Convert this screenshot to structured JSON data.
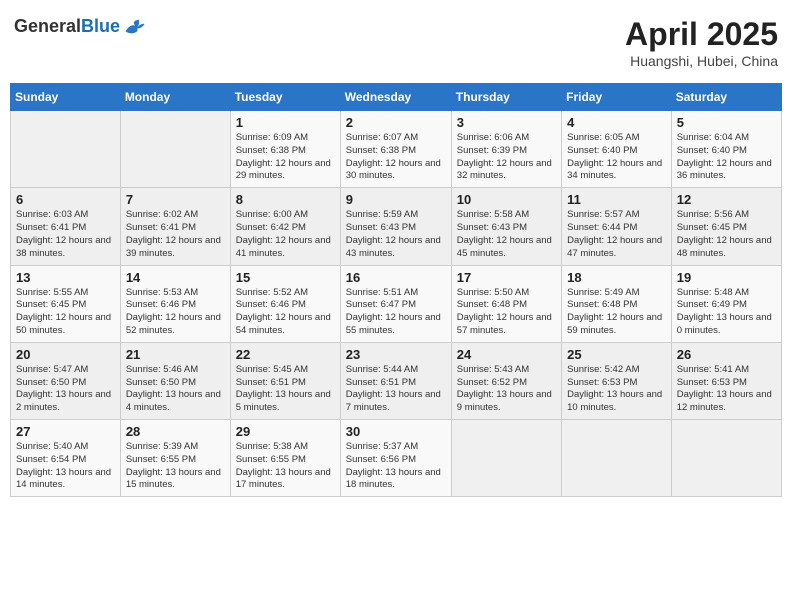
{
  "header": {
    "logo_general": "General",
    "logo_blue": "Blue",
    "month_title": "April 2025",
    "subtitle": "Huangshi, Hubei, China"
  },
  "days_of_week": [
    "Sunday",
    "Monday",
    "Tuesday",
    "Wednesday",
    "Thursday",
    "Friday",
    "Saturday"
  ],
  "weeks": [
    [
      {
        "day": "",
        "info": ""
      },
      {
        "day": "",
        "info": ""
      },
      {
        "day": "1",
        "info": "Sunrise: 6:09 AM\nSunset: 6:38 PM\nDaylight: 12 hours\nand 29 minutes."
      },
      {
        "day": "2",
        "info": "Sunrise: 6:07 AM\nSunset: 6:38 PM\nDaylight: 12 hours\nand 30 minutes."
      },
      {
        "day": "3",
        "info": "Sunrise: 6:06 AM\nSunset: 6:39 PM\nDaylight: 12 hours\nand 32 minutes."
      },
      {
        "day": "4",
        "info": "Sunrise: 6:05 AM\nSunset: 6:40 PM\nDaylight: 12 hours\nand 34 minutes."
      },
      {
        "day": "5",
        "info": "Sunrise: 6:04 AM\nSunset: 6:40 PM\nDaylight: 12 hours\nand 36 minutes."
      }
    ],
    [
      {
        "day": "6",
        "info": "Sunrise: 6:03 AM\nSunset: 6:41 PM\nDaylight: 12 hours\nand 38 minutes."
      },
      {
        "day": "7",
        "info": "Sunrise: 6:02 AM\nSunset: 6:41 PM\nDaylight: 12 hours\nand 39 minutes."
      },
      {
        "day": "8",
        "info": "Sunrise: 6:00 AM\nSunset: 6:42 PM\nDaylight: 12 hours\nand 41 minutes."
      },
      {
        "day": "9",
        "info": "Sunrise: 5:59 AM\nSunset: 6:43 PM\nDaylight: 12 hours\nand 43 minutes."
      },
      {
        "day": "10",
        "info": "Sunrise: 5:58 AM\nSunset: 6:43 PM\nDaylight: 12 hours\nand 45 minutes."
      },
      {
        "day": "11",
        "info": "Sunrise: 5:57 AM\nSunset: 6:44 PM\nDaylight: 12 hours\nand 47 minutes."
      },
      {
        "day": "12",
        "info": "Sunrise: 5:56 AM\nSunset: 6:45 PM\nDaylight: 12 hours\nand 48 minutes."
      }
    ],
    [
      {
        "day": "13",
        "info": "Sunrise: 5:55 AM\nSunset: 6:45 PM\nDaylight: 12 hours\nand 50 minutes."
      },
      {
        "day": "14",
        "info": "Sunrise: 5:53 AM\nSunset: 6:46 PM\nDaylight: 12 hours\nand 52 minutes."
      },
      {
        "day": "15",
        "info": "Sunrise: 5:52 AM\nSunset: 6:46 PM\nDaylight: 12 hours\nand 54 minutes."
      },
      {
        "day": "16",
        "info": "Sunrise: 5:51 AM\nSunset: 6:47 PM\nDaylight: 12 hours\nand 55 minutes."
      },
      {
        "day": "17",
        "info": "Sunrise: 5:50 AM\nSunset: 6:48 PM\nDaylight: 12 hours\nand 57 minutes."
      },
      {
        "day": "18",
        "info": "Sunrise: 5:49 AM\nSunset: 6:48 PM\nDaylight: 12 hours\nand 59 minutes."
      },
      {
        "day": "19",
        "info": "Sunrise: 5:48 AM\nSunset: 6:49 PM\nDaylight: 13 hours\nand 0 minutes."
      }
    ],
    [
      {
        "day": "20",
        "info": "Sunrise: 5:47 AM\nSunset: 6:50 PM\nDaylight: 13 hours\nand 2 minutes."
      },
      {
        "day": "21",
        "info": "Sunrise: 5:46 AM\nSunset: 6:50 PM\nDaylight: 13 hours\nand 4 minutes."
      },
      {
        "day": "22",
        "info": "Sunrise: 5:45 AM\nSunset: 6:51 PM\nDaylight: 13 hours\nand 5 minutes."
      },
      {
        "day": "23",
        "info": "Sunrise: 5:44 AM\nSunset: 6:51 PM\nDaylight: 13 hours\nand 7 minutes."
      },
      {
        "day": "24",
        "info": "Sunrise: 5:43 AM\nSunset: 6:52 PM\nDaylight: 13 hours\nand 9 minutes."
      },
      {
        "day": "25",
        "info": "Sunrise: 5:42 AM\nSunset: 6:53 PM\nDaylight: 13 hours\nand 10 minutes."
      },
      {
        "day": "26",
        "info": "Sunrise: 5:41 AM\nSunset: 6:53 PM\nDaylight: 13 hours\nand 12 minutes."
      }
    ],
    [
      {
        "day": "27",
        "info": "Sunrise: 5:40 AM\nSunset: 6:54 PM\nDaylight: 13 hours\nand 14 minutes."
      },
      {
        "day": "28",
        "info": "Sunrise: 5:39 AM\nSunset: 6:55 PM\nDaylight: 13 hours\nand 15 minutes."
      },
      {
        "day": "29",
        "info": "Sunrise: 5:38 AM\nSunset: 6:55 PM\nDaylight: 13 hours\nand 17 minutes."
      },
      {
        "day": "30",
        "info": "Sunrise: 5:37 AM\nSunset: 6:56 PM\nDaylight: 13 hours\nand 18 minutes."
      },
      {
        "day": "",
        "info": ""
      },
      {
        "day": "",
        "info": ""
      },
      {
        "day": "",
        "info": ""
      }
    ]
  ]
}
